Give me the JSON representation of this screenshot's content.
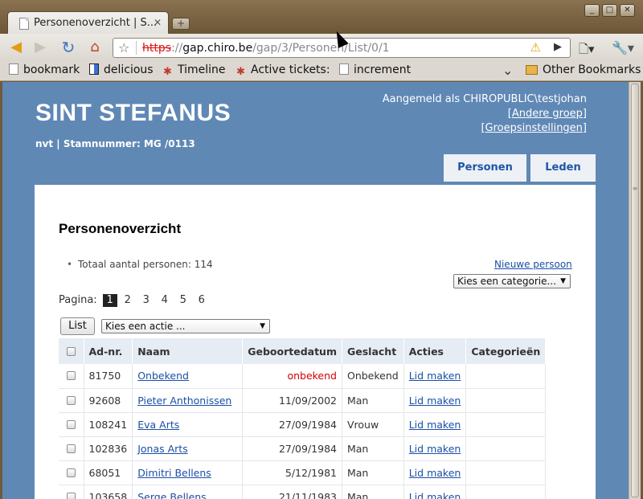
{
  "browser": {
    "tab_title": "Personenoverzicht | S...",
    "tab_close": "✕",
    "new_tab": "+",
    "window_buttons": [
      "_",
      "□",
      "✕"
    ],
    "url_scheme": "https",
    "url_sep": "://",
    "url_host": "gap.chiro.be",
    "url_path": "/gap/3/Personen/List/0/1",
    "bookmarks": [
      "bookmark",
      "delicious",
      "Timeline",
      "Active tickets:",
      "increment"
    ],
    "other_bookmarks": "Other Bookmarks"
  },
  "header": {
    "group_name": "SINT STEFANUS",
    "subtitle": "nvt | Stamnummer: MG /0113",
    "logged_in": "Aangemeld als CHIROPUBLIC\\testjohan",
    "link_other_group": "[Andere groep]",
    "link_group_settings": "[Groepsinstellingen]",
    "tabs": [
      "Personen",
      "Leden"
    ]
  },
  "main": {
    "title": "Personenoverzicht",
    "total": "Totaal aantal personen: 114",
    "new_person": "Nieuwe persoon",
    "category_select": "Kies een categorie...",
    "paging_label": "Pagina:",
    "pages": [
      "1",
      "2",
      "3",
      "4",
      "5",
      "6"
    ],
    "list_button": "List",
    "action_select": "Kies een actie ...",
    "columns": [
      "Ad-nr.",
      "Naam",
      "Geboortedatum",
      "Geslacht",
      "Acties",
      "Categorieën"
    ],
    "rows": [
      {
        "adnr": "81750",
        "naam": "Onbekend",
        "geboorte": "onbekend",
        "geslacht": "Onbekend",
        "actie": "Lid maken",
        "cat": ""
      },
      {
        "adnr": "92608",
        "naam": "Pieter Anthonissen",
        "geboorte": "11/09/2002",
        "geslacht": "Man",
        "actie": "Lid maken",
        "cat": ""
      },
      {
        "adnr": "108241",
        "naam": "Eva Arts",
        "geboorte": "27/09/1984",
        "geslacht": "Vrouw",
        "actie": "Lid maken",
        "cat": ""
      },
      {
        "adnr": "102836",
        "naam": "Jonas Arts",
        "geboorte": "27/09/1984",
        "geslacht": "Man",
        "actie": "Lid maken",
        "cat": ""
      },
      {
        "adnr": "68051",
        "naam": "Dimitri Bellens",
        "geboorte": "5/12/1981",
        "geslacht": "Man",
        "actie": "Lid maken",
        "cat": ""
      },
      {
        "adnr": "103658",
        "naam": "Serge Bellens",
        "geboorte": "21/11/1983",
        "geslacht": "Man",
        "actie": "Lid maken",
        "cat": ""
      }
    ]
  },
  "colors": {
    "page_bg": "#5f88b5",
    "link": "#1a4fa8",
    "unknown_date": "#d40000"
  }
}
